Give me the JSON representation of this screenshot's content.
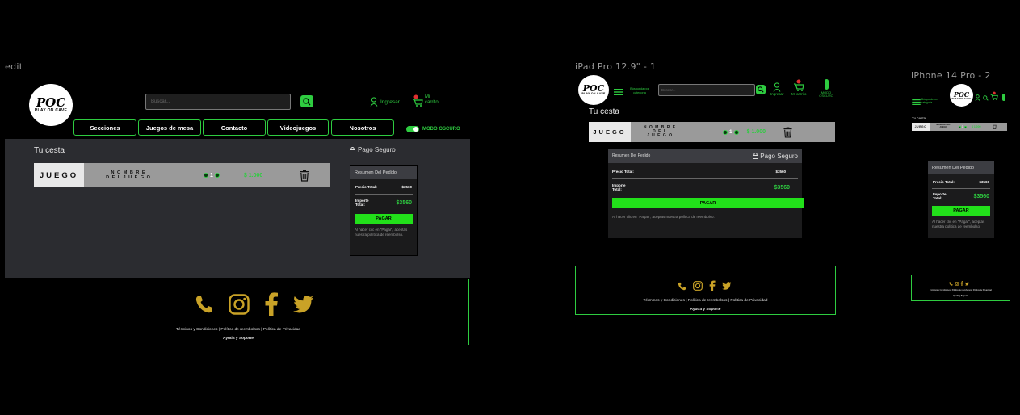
{
  "frames": {
    "desktop_label": "edit",
    "ipad_label": "iPad Pro 12.9\" - 1",
    "iphone_label": "iPhone 14 Pro - 2"
  },
  "brand": {
    "logo_big": "POC",
    "logo_small": "PLAY ON CAVE"
  },
  "search": {
    "placeholder": "Buscar..."
  },
  "header": {
    "login": "Ingresar",
    "cart_line1": "Mi",
    "cart_line2": "carrito",
    "cart_short": "Mi carrito",
    "dark_mode": "MODO OSCURO",
    "search_by_category": "Búsqueda por categoría"
  },
  "nav": [
    "Secciones",
    "Juegos de mesa",
    "Contacto",
    "Videojuegos",
    "Nosotros"
  ],
  "cart": {
    "title": "Tu cesta",
    "secure": "Pago Seguro",
    "item": {
      "type": "JUEGO",
      "name": "NOMBRE DEL JUEGO",
      "name_l1": "N O M B R E",
      "name_l2": "D E L   J U E G O",
      "name_ipad_l1": "N O M B R E",
      "name_ipad_l2": "D E L",
      "name_ipad_l3": "J U E G O",
      "qty": "1",
      "price": "$ 1.000"
    }
  },
  "summary": {
    "title": "Resumen Del Pedido",
    "precio_label": "Precio Total:",
    "precio_value": "$3560",
    "importe_label": "Importe Total:",
    "importe_value": "$3560",
    "pay_label": "PAGAR",
    "note": "Al hacer clic en \"Pagar\", aceptas nuestra política de reembolso."
  },
  "footer": {
    "terms": "Términos y Condiciones",
    "refund": "Política de reembolsos",
    "privacy": "Política de Privacidad",
    "help": "Ayuda y Soporte"
  },
  "colors": {
    "accent": "#2ecc40",
    "gold": "#c9a227",
    "panel": "#2b2c30",
    "pay": "#22e01a"
  }
}
